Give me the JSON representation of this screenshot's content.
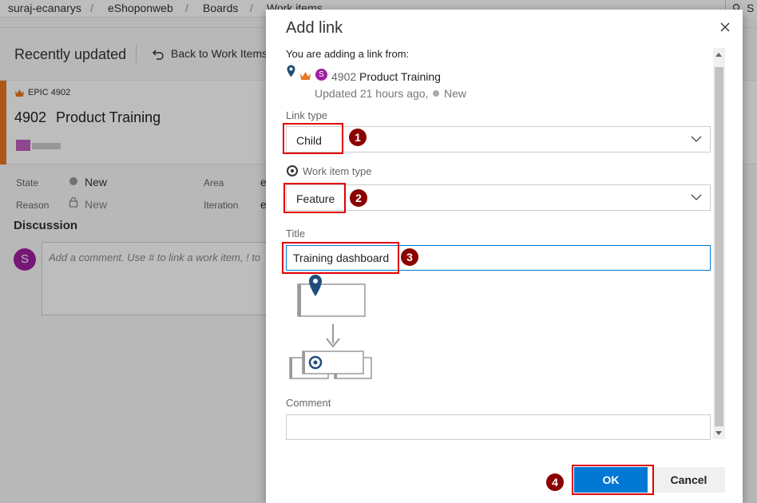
{
  "breadcrumb": {
    "items": [
      "suraj-ecanarys",
      "eShoponweb",
      "Boards",
      "Work items"
    ],
    "separator": "/"
  },
  "top_search": {
    "letter": "S"
  },
  "subheader": {
    "recent_label": "Recently updated",
    "back_label": "Back to Work Items"
  },
  "work_item": {
    "type_label": "EPIC 4902",
    "id": "4902",
    "title": "Product Training",
    "fields": {
      "state_label": "State",
      "state_value": "New",
      "reason_label": "Reason",
      "reason_value": "New",
      "area_label": "Area",
      "area_value": "e",
      "iteration_label": "Iteration",
      "iteration_value": "e"
    }
  },
  "discussion": {
    "heading": "Discussion",
    "avatar_letter": "S",
    "placeholder": "Add a comment. Use # to link a work item, ! to"
  },
  "dialog": {
    "title": "Add link",
    "from_label": "You are adding a link from:",
    "from_avatar": "S",
    "from_id": "4902",
    "from_title": "Product Training",
    "from_updated": "Updated 21 hours ago,",
    "from_state": "New",
    "link_type_label": "Link type",
    "link_type_value": "Child",
    "work_item_type_label": "Work item type",
    "work_item_type_value": "Feature",
    "title_label": "Title",
    "title_value": "Training dashboard",
    "comment_label": "Comment",
    "ok_label": "OK",
    "cancel_label": "Cancel"
  },
  "annotations": [
    "1",
    "2",
    "3",
    "4"
  ],
  "colors": {
    "accent": "#0078d4",
    "epic_orange": "#e87722",
    "avatar_purple": "#a020a0",
    "highlight_red": "#e00000",
    "badge_dark_red": "#8b0000",
    "icon_navy": "#1e4e79"
  }
}
